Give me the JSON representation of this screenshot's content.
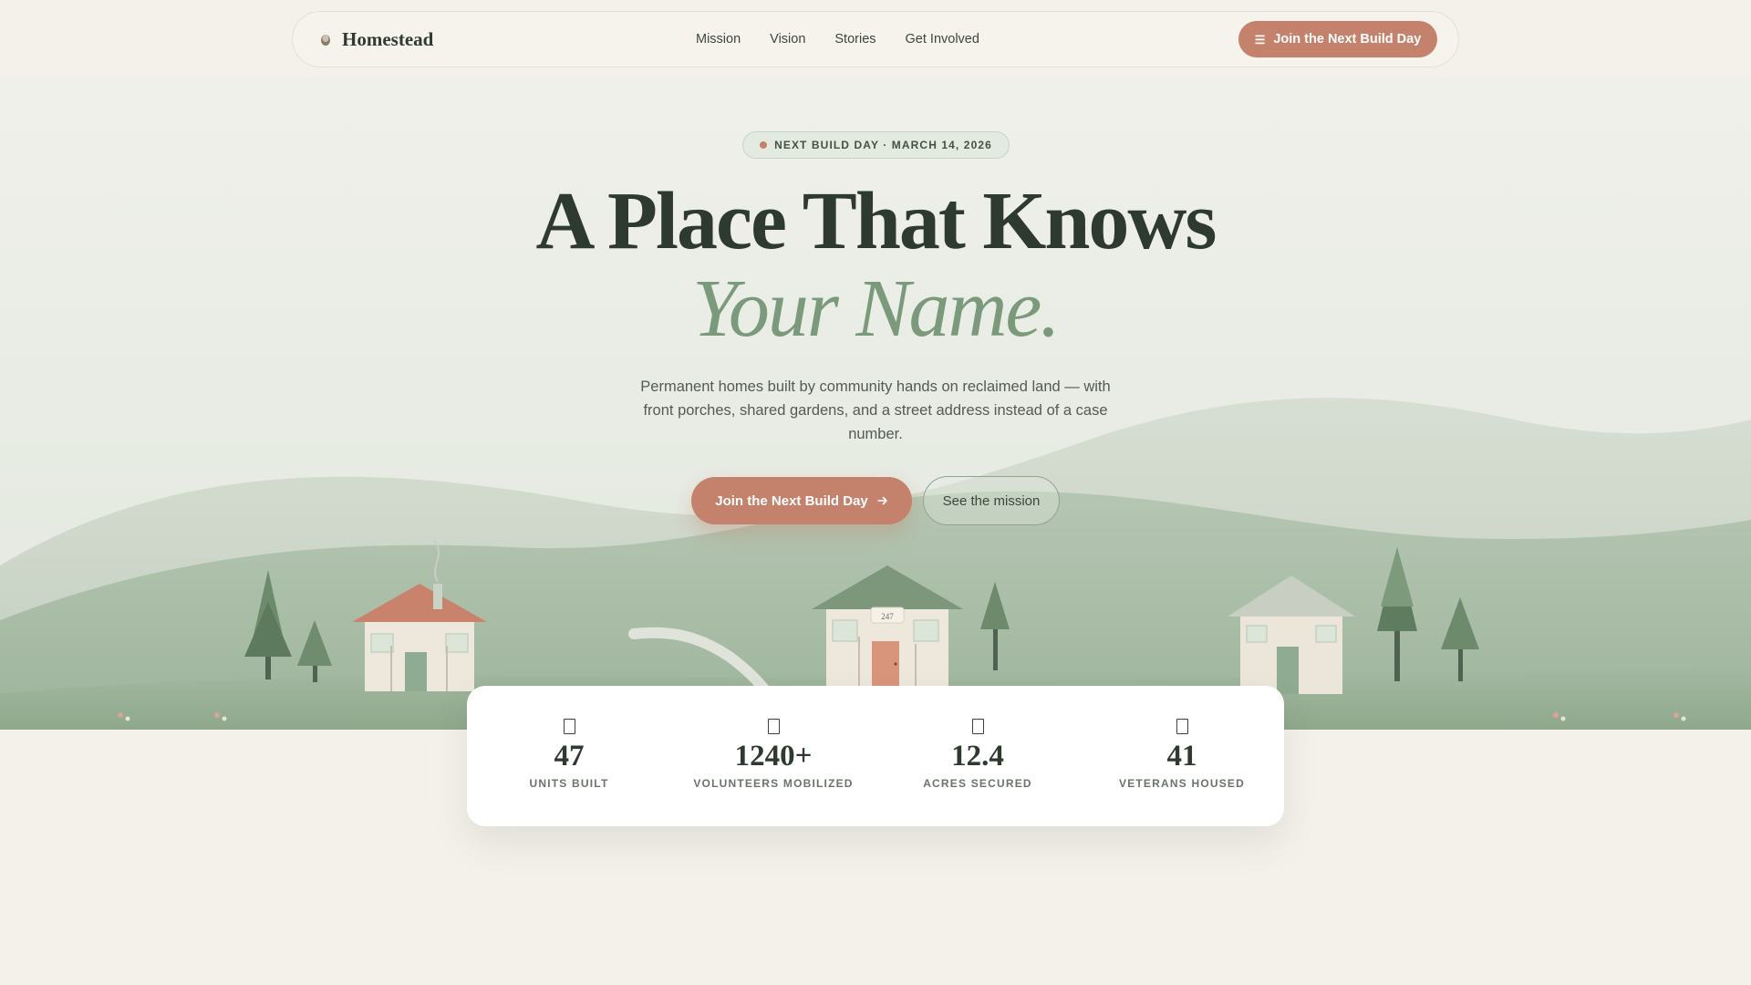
{
  "brand": {
    "name": "Homestead"
  },
  "nav": {
    "links": [
      "Mission",
      "Vision",
      "Stories",
      "Get Involved"
    ],
    "cta_label": "Join the Next Build Day",
    "cta_icon": "menu-icon"
  },
  "hero": {
    "badge": "NEXT BUILD DAY · MARCH 14, 2026",
    "title_line1": "A Place That Knows",
    "title_line2": "Your Name.",
    "subtitle": "Permanent homes built by community hands on reclaimed land — with front porches, shared gardens, and a street address instead of a case number.",
    "primary_button": "Join the Next Build Day",
    "secondary_button": "See the mission",
    "house_number": "247"
  },
  "stats": [
    {
      "value": "47",
      "label": "UNITS BUILT"
    },
    {
      "value": "1240+",
      "label": "VOLUNTEERS MOBILIZED"
    },
    {
      "value": "12.4",
      "label": "ACRES SECURED"
    },
    {
      "value": "41",
      "label": "VETERANS HOUSED"
    }
  ],
  "colors": {
    "accent": "#c4816b",
    "sage": "#7b9a7c",
    "ink": "#2e392f",
    "background": "#f4f1ea"
  }
}
